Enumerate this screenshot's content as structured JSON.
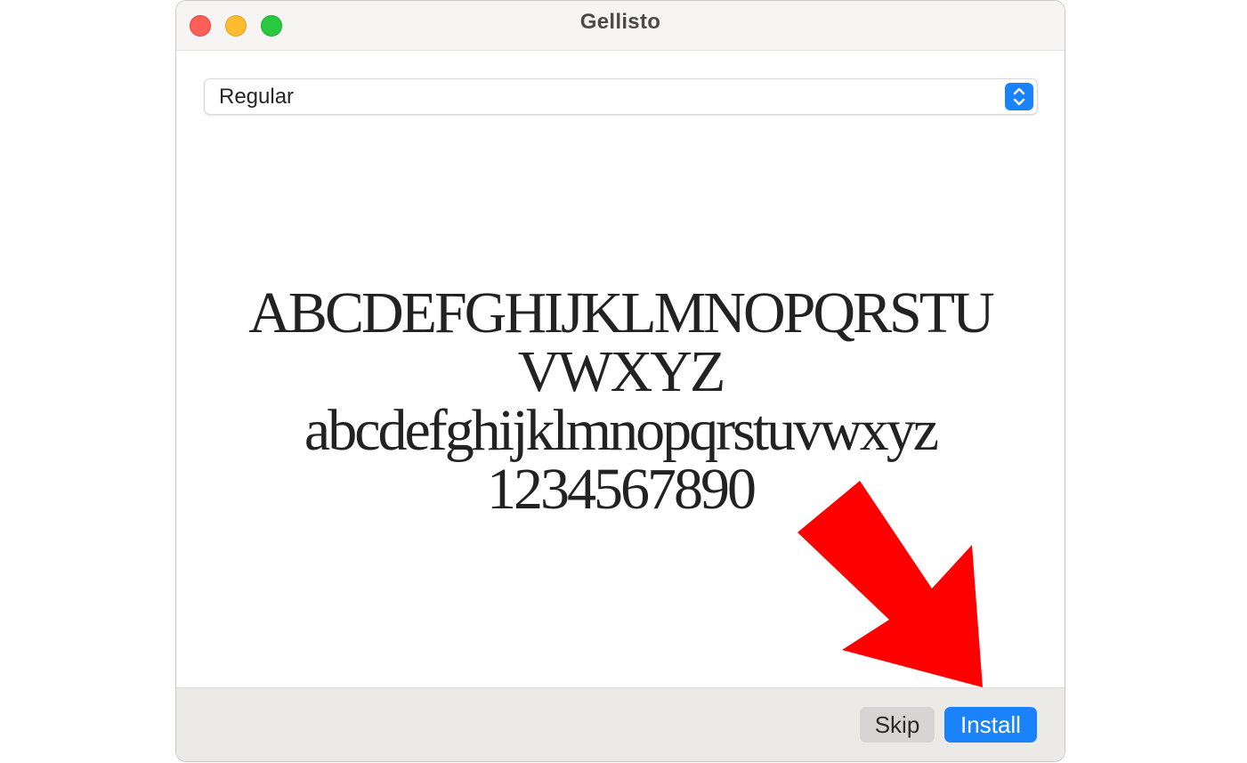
{
  "window": {
    "title": "Gellisto"
  },
  "style_select": {
    "value": "Regular"
  },
  "preview": {
    "uppercase_line1": "ABCDEFGHIJKLMNOPQRSTU",
    "uppercase_line2": "VWXYZ",
    "lowercase": "abcdefghijklmnopqrstuvwxyz",
    "digits": "1234567890"
  },
  "buttons": {
    "skip": "Skip",
    "install": "Install"
  },
  "colors": {
    "accent": "#1a82fb",
    "close": "#fe5f57",
    "minimize": "#febc2e",
    "zoom": "#28c840",
    "annotation_arrow": "#ff0000"
  },
  "icons": {
    "select_stepper": "chevron-up-down-icon",
    "annotation": "red-arrow-pointing-to-install"
  }
}
